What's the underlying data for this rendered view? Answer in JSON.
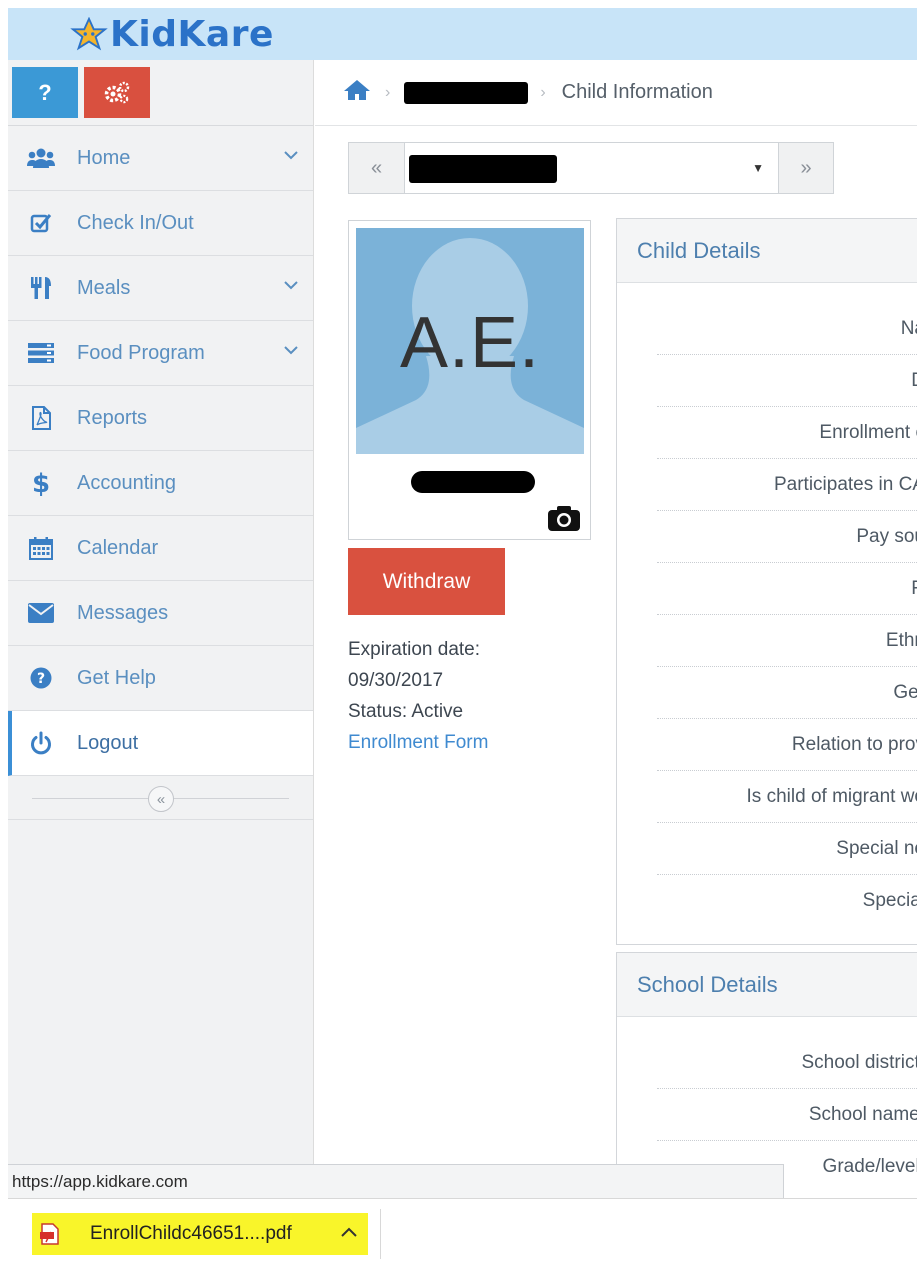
{
  "app": {
    "brand": "KidKare"
  },
  "sidebar": {
    "help_label": "?",
    "items": [
      {
        "label": "Home",
        "icon": "users-icon",
        "has_submenu": true
      },
      {
        "label": "Check In/Out",
        "icon": "checkbox-icon",
        "has_submenu": false
      },
      {
        "label": "Meals",
        "icon": "utensils-icon",
        "has_submenu": true
      },
      {
        "label": "Food Program",
        "icon": "server-icon",
        "has_submenu": true
      },
      {
        "label": "Reports",
        "icon": "pdf-icon",
        "has_submenu": false
      },
      {
        "label": "Accounting",
        "icon": "dollar-icon",
        "has_submenu": false
      },
      {
        "label": "Calendar",
        "icon": "calendar-icon",
        "has_submenu": false
      },
      {
        "label": "Messages",
        "icon": "envelope-icon",
        "has_submenu": false
      },
      {
        "label": "Get Help",
        "icon": "question-circle-icon",
        "has_submenu": false
      },
      {
        "label": "Logout",
        "icon": "power-icon",
        "has_submenu": false,
        "active": true
      }
    ],
    "collapse_glyph": "«"
  },
  "breadcrumb": {
    "current": "Child Information"
  },
  "child_selector": {
    "prev": "«",
    "next": "»"
  },
  "child": {
    "initials": "A.E.",
    "withdraw_label": "Withdraw",
    "expiration_label": "Expiration date:",
    "expiration_date": "09/30/2017",
    "status": "Status: Active",
    "enrollment_link": "Enrollment Form"
  },
  "child_details": {
    "title": "Child Details",
    "rows": [
      "Na",
      "D",
      "Enrollment c",
      "Participates in CA",
      "Pay sou",
      "R",
      "Ethn",
      "Ger",
      "Relation to prov",
      "Is child of migrant wo",
      "Special ne",
      "Special"
    ]
  },
  "school_details": {
    "title": "School Details",
    "rows": [
      "School district:",
      "School name:",
      "Grade/level:"
    ]
  },
  "browser": {
    "status_url": "https://app.kidkare.com",
    "download_filename": "EnrollChildc46651....pdf"
  },
  "colors": {
    "accent": "#3b8fd6",
    "danger": "#d9513f",
    "topbar": "#c8e4f8",
    "download_highlight": "#f9f52a"
  }
}
